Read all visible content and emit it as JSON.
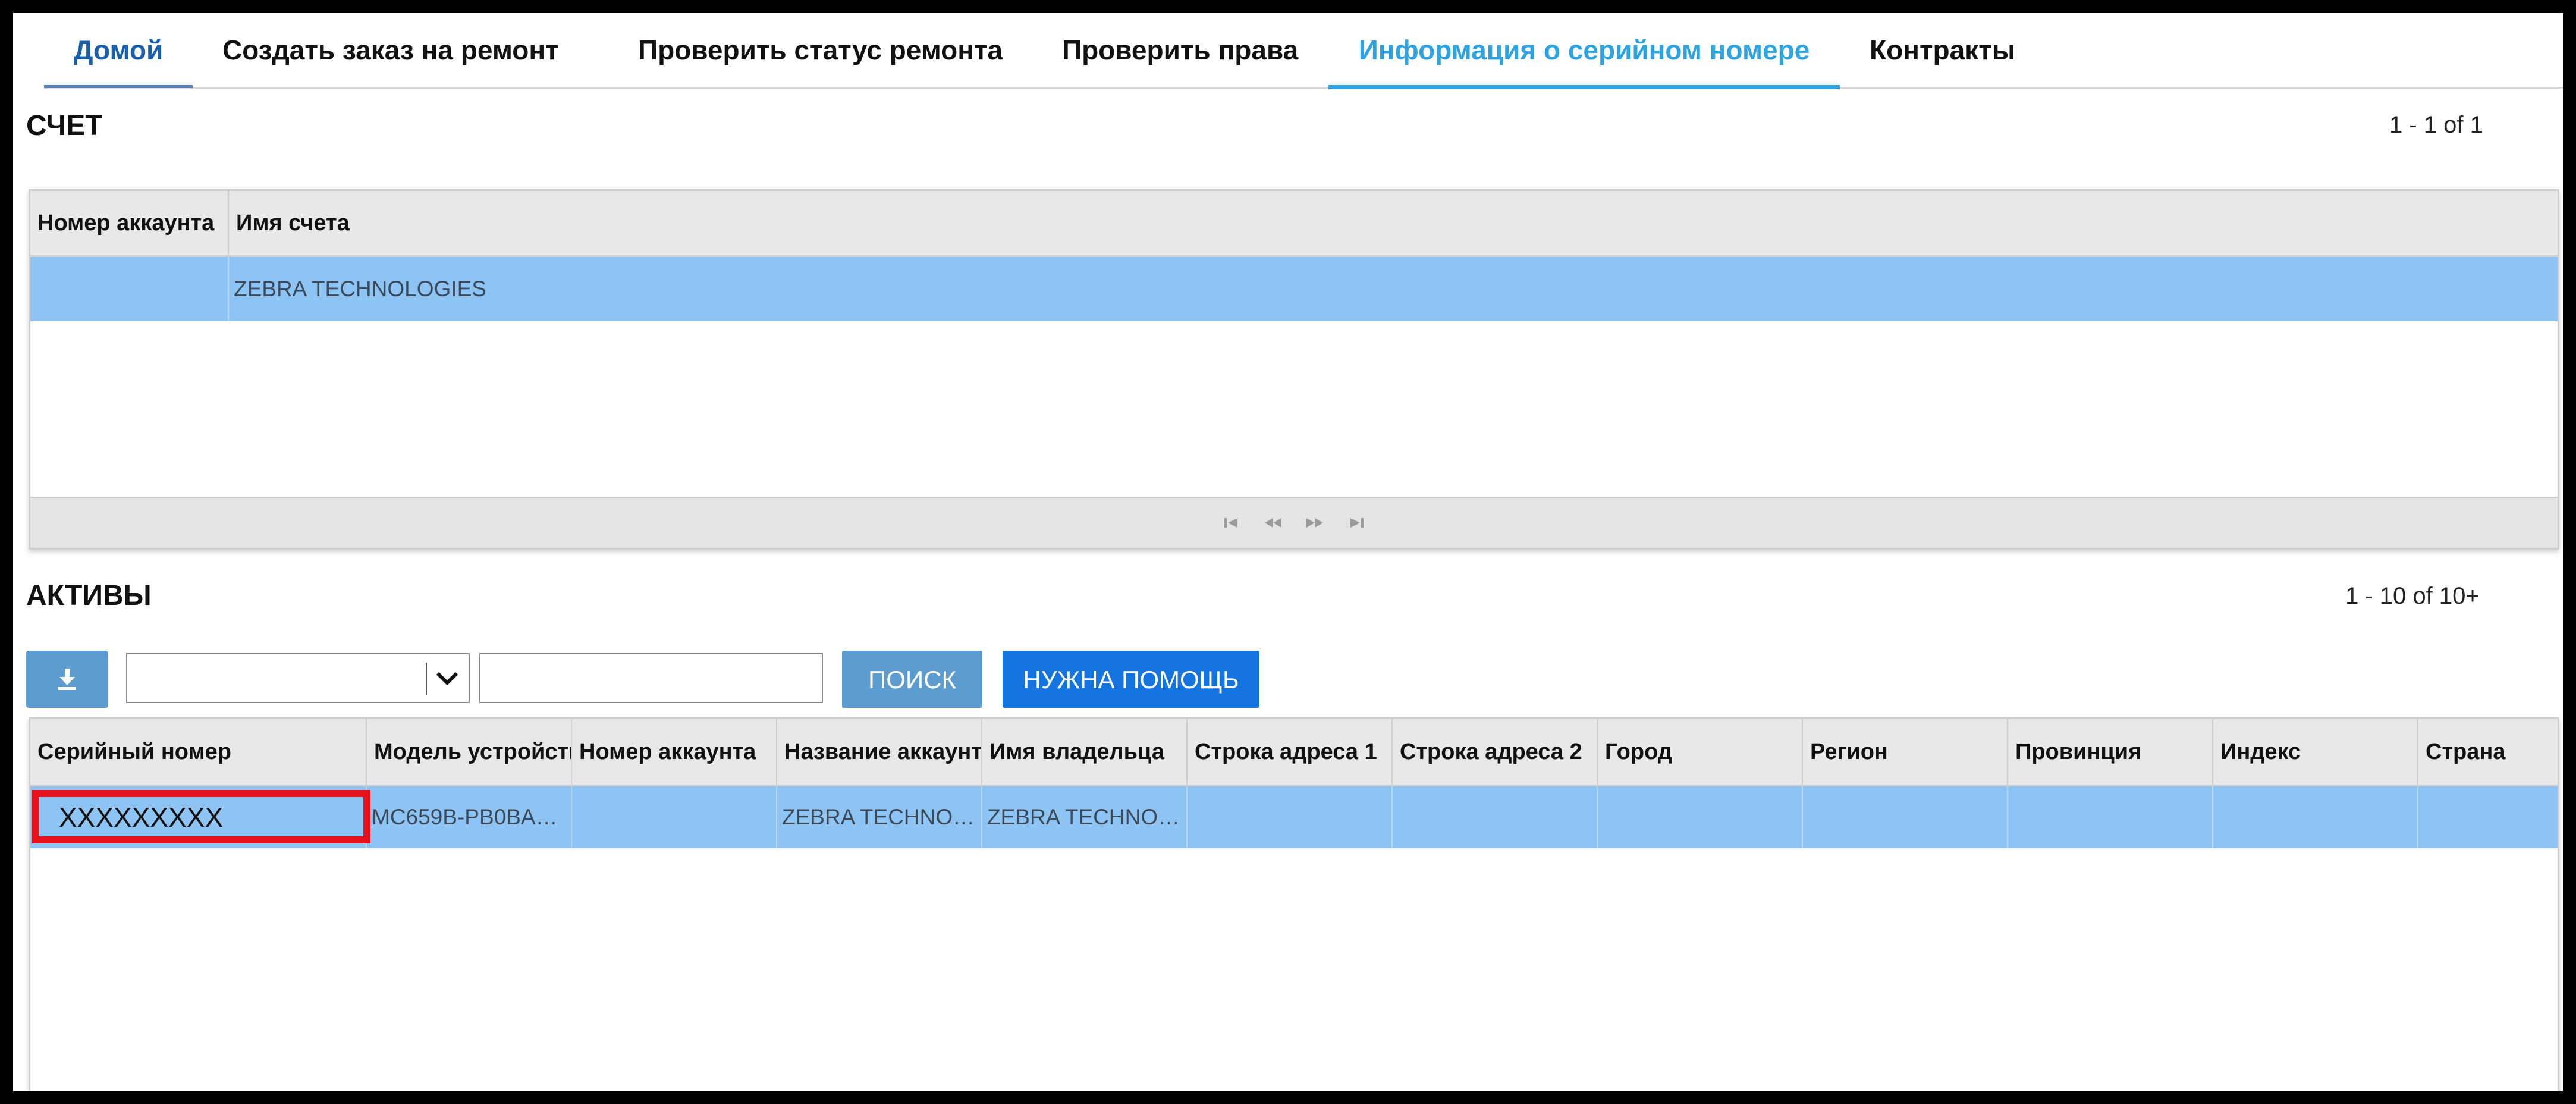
{
  "tabs": [
    {
      "label": "Домой"
    },
    {
      "label": "Создать заказ на ремонт"
    },
    {
      "label": "Проверить статус ремонта"
    },
    {
      "label": "Проверить права"
    },
    {
      "label": "Информация о серийном номере"
    },
    {
      "label": "Контракты"
    }
  ],
  "accounts": {
    "title": "СЧЕТ",
    "range": "1 - 1 of 1",
    "columns": [
      "Номер аккаунта",
      "Имя счета"
    ],
    "rows": [
      {
        "account_number": "",
        "account_name": "ZEBRA TECHNOLOGIES"
      }
    ]
  },
  "assets": {
    "title": "АКТИВЫ",
    "range": "1 - 10 of 10+",
    "search_button": "ПОИСК",
    "help_button": "НУЖНА ПОМОЩЬ",
    "select_value": "",
    "search_value": "",
    "columns": [
      "Серийный номер",
      "Модель устройства",
      "Номер аккаунта",
      "Название аккаунта",
      "Имя владельца",
      "Строка адреса 1",
      "Строка адреса 2",
      "Город",
      "Регион",
      "Провинция",
      "Индекс",
      "Страна"
    ],
    "rows": [
      {
        "serial": "XXXXXXXXX",
        "model": "MC659B-PB0BA…",
        "account_number": "",
        "account_name": "ZEBRA TECHNO…",
        "owner": "ZEBRA TECHNO…",
        "address1": "",
        "address2": "",
        "city": "",
        "region": "",
        "province": "",
        "zip": "",
        "country": ""
      }
    ]
  },
  "colors": {
    "accent_active_tab": "#2ea3e0",
    "row_selected": "#8ec4f4",
    "help_button": "#1474e0",
    "search_button": "#5c9ccf",
    "highlight": "#e8121c"
  }
}
